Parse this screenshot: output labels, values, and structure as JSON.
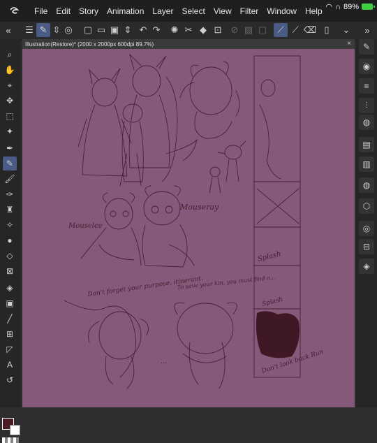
{
  "menu": [
    "File",
    "Edit",
    "Story",
    "Animation",
    "Layer",
    "Select",
    "View",
    "Filter",
    "Window",
    "Help"
  ],
  "status": {
    "battery": "89%"
  },
  "tab": {
    "title": "Illustration(Restore)* (2000 x 2000px 600dpi 89.7%)"
  },
  "sketch_labels": {
    "mouse_left": "Mouselee",
    "mouse_right": "Mouseray",
    "note_left": "Don't forget your purpose, itinerant.",
    "note_right": "To save your kin, you must find a...",
    "ellipsis": "...",
    "splash1": "Splash",
    "splash2": "Splash",
    "dont_look": "Don't look back Run"
  },
  "colors": {
    "canvas": "#86597a",
    "main": "#4a1d25",
    "sub": "#ffffff"
  }
}
